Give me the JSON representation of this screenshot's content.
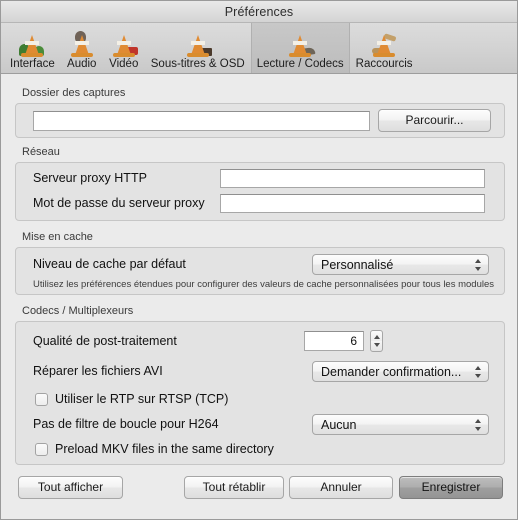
{
  "window": {
    "title": "Préférences"
  },
  "toolbar": {
    "tabs": [
      {
        "label": "Interface",
        "icon": "vlc-cone-interface-icon",
        "selected": false
      },
      {
        "label": "Audio",
        "icon": "vlc-cone-audio-icon",
        "selected": false
      },
      {
        "label": "Vidéo",
        "icon": "vlc-cone-video-icon",
        "selected": false
      },
      {
        "label": "Sous-titres & OSD",
        "icon": "vlc-cone-subtitles-icon",
        "selected": false
      },
      {
        "label": "Lecture / Codecs",
        "icon": "vlc-cone-playback-icon",
        "selected": true
      },
      {
        "label": "Raccourcis",
        "icon": "vlc-cone-hotkeys-icon",
        "selected": false
      }
    ]
  },
  "captures": {
    "group_label": "Dossier des captures",
    "path_value": "",
    "browse_label": "Parcourir..."
  },
  "network": {
    "group_label": "Réseau",
    "proxy_label": "Serveur proxy HTTP",
    "proxy_value": "",
    "password_label": "Mot de passe du serveur proxy",
    "password_value": ""
  },
  "caching": {
    "group_label": "Mise en cache",
    "level_label": "Niveau de cache par défaut",
    "level_value": "Personnalisé",
    "hint": "Utilisez les préférences étendues pour configurer des valeurs de cache personnalisées pour tous les modules"
  },
  "codecs": {
    "group_label": "Codecs / Multiplexeurs",
    "postproc_label": "Qualité de post-traitement",
    "postproc_value": "6",
    "avi_label": "Réparer les fichiers AVI",
    "avi_value": "Demander confirmation...",
    "rtp_label": "Utiliser le RTP sur RTSP (TCP)",
    "rtp_checked": false,
    "h264_label": "Pas de filtre de boucle pour H264",
    "h264_value": "Aucun",
    "mkv_label": "Preload MKV files in the same directory",
    "mkv_checked": false
  },
  "footer": {
    "show_all_label": "Tout afficher",
    "reset_all_label": "Tout rétablir",
    "cancel_label": "Annuler",
    "save_label": "Enregistrer"
  },
  "colors": {
    "window_bg": "#ebebeb",
    "group_bg": "#e3e3e3",
    "group_border": "#c6c6c6",
    "toolbar_top": "#dcdcdc",
    "selected_tab": "#c8c8c8",
    "default_button": "#aeaeae",
    "cone_orange": "#e08b33"
  }
}
